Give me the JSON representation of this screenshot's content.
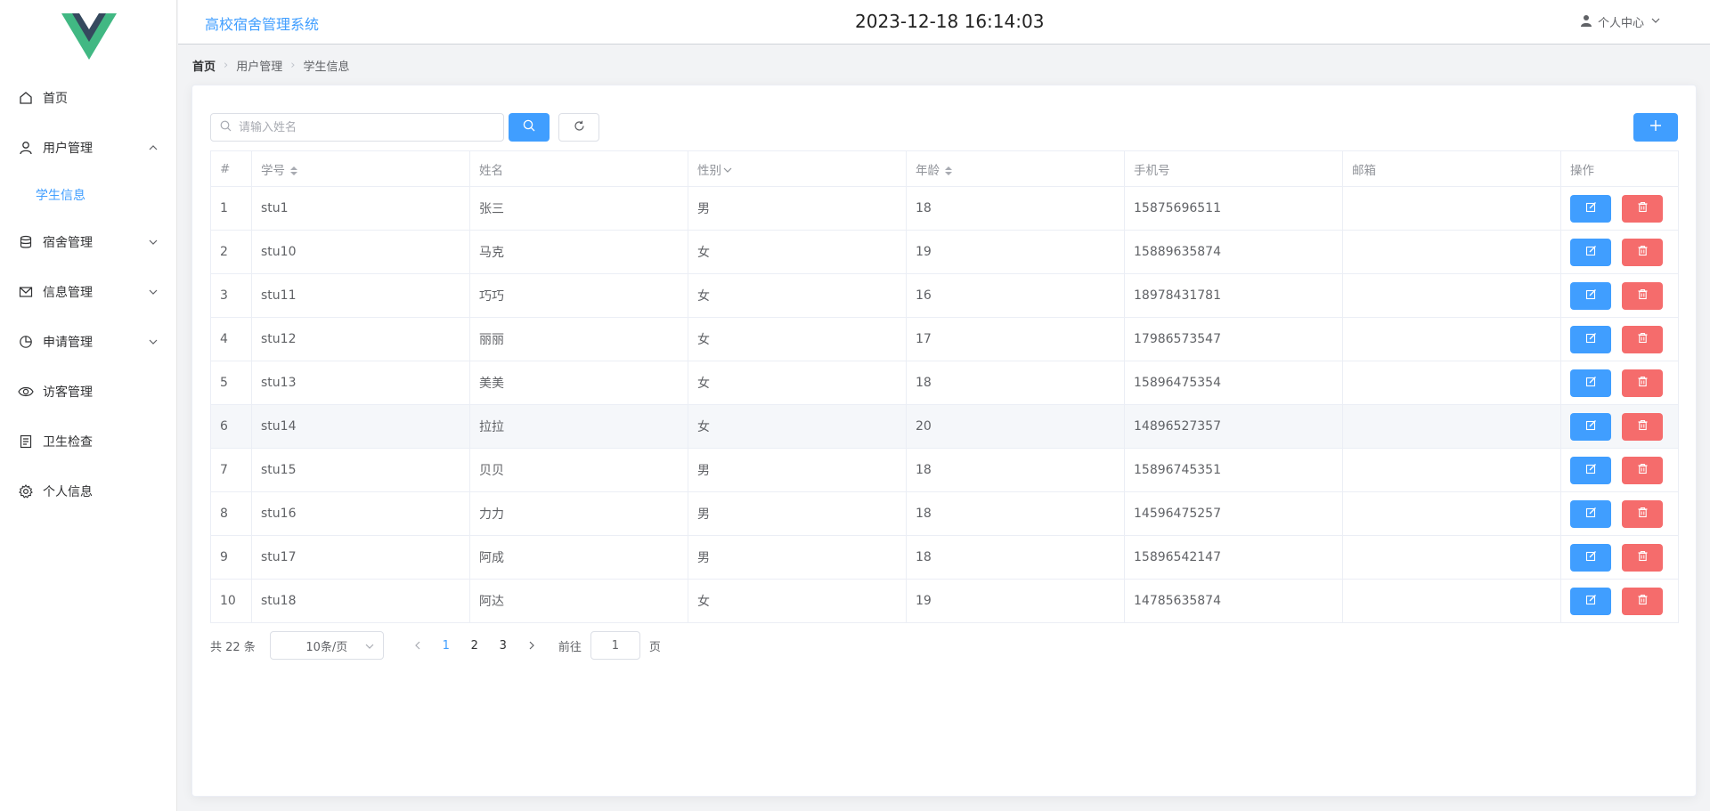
{
  "app": {
    "title": "高校宿舍管理系统",
    "datetime": "2023-12-18 16:14:03",
    "user_menu": "个人中心"
  },
  "sidebar": {
    "items": [
      {
        "label": "首页",
        "icon": "home-icon"
      },
      {
        "label": "用户管理",
        "icon": "user-icon",
        "expanded": true,
        "children": [
          {
            "label": "学生信息",
            "active": true
          }
        ]
      },
      {
        "label": "宿舍管理",
        "icon": "database-icon"
      },
      {
        "label": "信息管理",
        "icon": "message-icon"
      },
      {
        "label": "申请管理",
        "icon": "pie-chart-icon"
      },
      {
        "label": "访客管理",
        "icon": "eye-icon"
      },
      {
        "label": "卫生检查",
        "icon": "document-icon"
      },
      {
        "label": "个人信息",
        "icon": "gear-icon"
      }
    ]
  },
  "breadcrumb": [
    "首页",
    "用户管理",
    "学生信息"
  ],
  "search": {
    "placeholder": "请输入姓名",
    "value": ""
  },
  "table": {
    "columns": [
      "#",
      "学号",
      "姓名",
      "性别",
      "年龄",
      "手机号",
      "邮箱",
      "操作"
    ],
    "rows": [
      {
        "index": "1",
        "id": "stu1",
        "name": "张三",
        "gender": "男",
        "age": "18",
        "phone": "15875696511",
        "email": ""
      },
      {
        "index": "2",
        "id": "stu10",
        "name": "马克",
        "gender": "女",
        "age": "19",
        "phone": "15889635874",
        "email": ""
      },
      {
        "index": "3",
        "id": "stu11",
        "name": "巧巧",
        "gender": "女",
        "age": "16",
        "phone": "18978431781",
        "email": ""
      },
      {
        "index": "4",
        "id": "stu12",
        "name": "丽丽",
        "gender": "女",
        "age": "17",
        "phone": "17986573547",
        "email": ""
      },
      {
        "index": "5",
        "id": "stu13",
        "name": "美美",
        "gender": "女",
        "age": "18",
        "phone": "15896475354",
        "email": ""
      },
      {
        "index": "6",
        "id": "stu14",
        "name": "拉拉",
        "gender": "女",
        "age": "20",
        "phone": "14896527357",
        "email": "",
        "highlighted": true
      },
      {
        "index": "7",
        "id": "stu15",
        "name": "贝贝",
        "gender": "男",
        "age": "18",
        "phone": "15896745351",
        "email": ""
      },
      {
        "index": "8",
        "id": "stu16",
        "name": "力力",
        "gender": "男",
        "age": "18",
        "phone": "14596475257",
        "email": ""
      },
      {
        "index": "9",
        "id": "stu17",
        "name": "阿成",
        "gender": "男",
        "age": "18",
        "phone": "15896542147",
        "email": ""
      },
      {
        "index": "10",
        "id": "stu18",
        "name": "阿达",
        "gender": "女",
        "age": "19",
        "phone": "14785635874",
        "email": ""
      }
    ]
  },
  "pagination": {
    "total_text": "共 22 条",
    "page_size": "10条/页",
    "pages": [
      "1",
      "2",
      "3"
    ],
    "current_page": "1",
    "goto_label": "前往",
    "goto_value": "1",
    "page_unit": "页"
  },
  "colors": {
    "primary": "#409eff",
    "danger": "#f56c6c",
    "logo_dark": "#35495e",
    "logo_green": "#41b883"
  }
}
